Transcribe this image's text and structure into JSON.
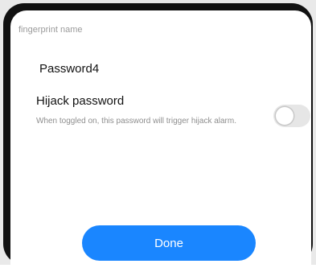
{
  "dialog": {
    "field_label": "fingerprint name",
    "fingerprint_name": "Password4",
    "hijack": {
      "title": "Hijack password",
      "description": "When toggled on, this password will trigger hijack alarm.",
      "toggle_on": false
    },
    "done_label": "Done"
  },
  "colors": {
    "accent": "#1a86ff",
    "device_bezel": "#111111",
    "toggle_off": "#e6e6e6"
  }
}
